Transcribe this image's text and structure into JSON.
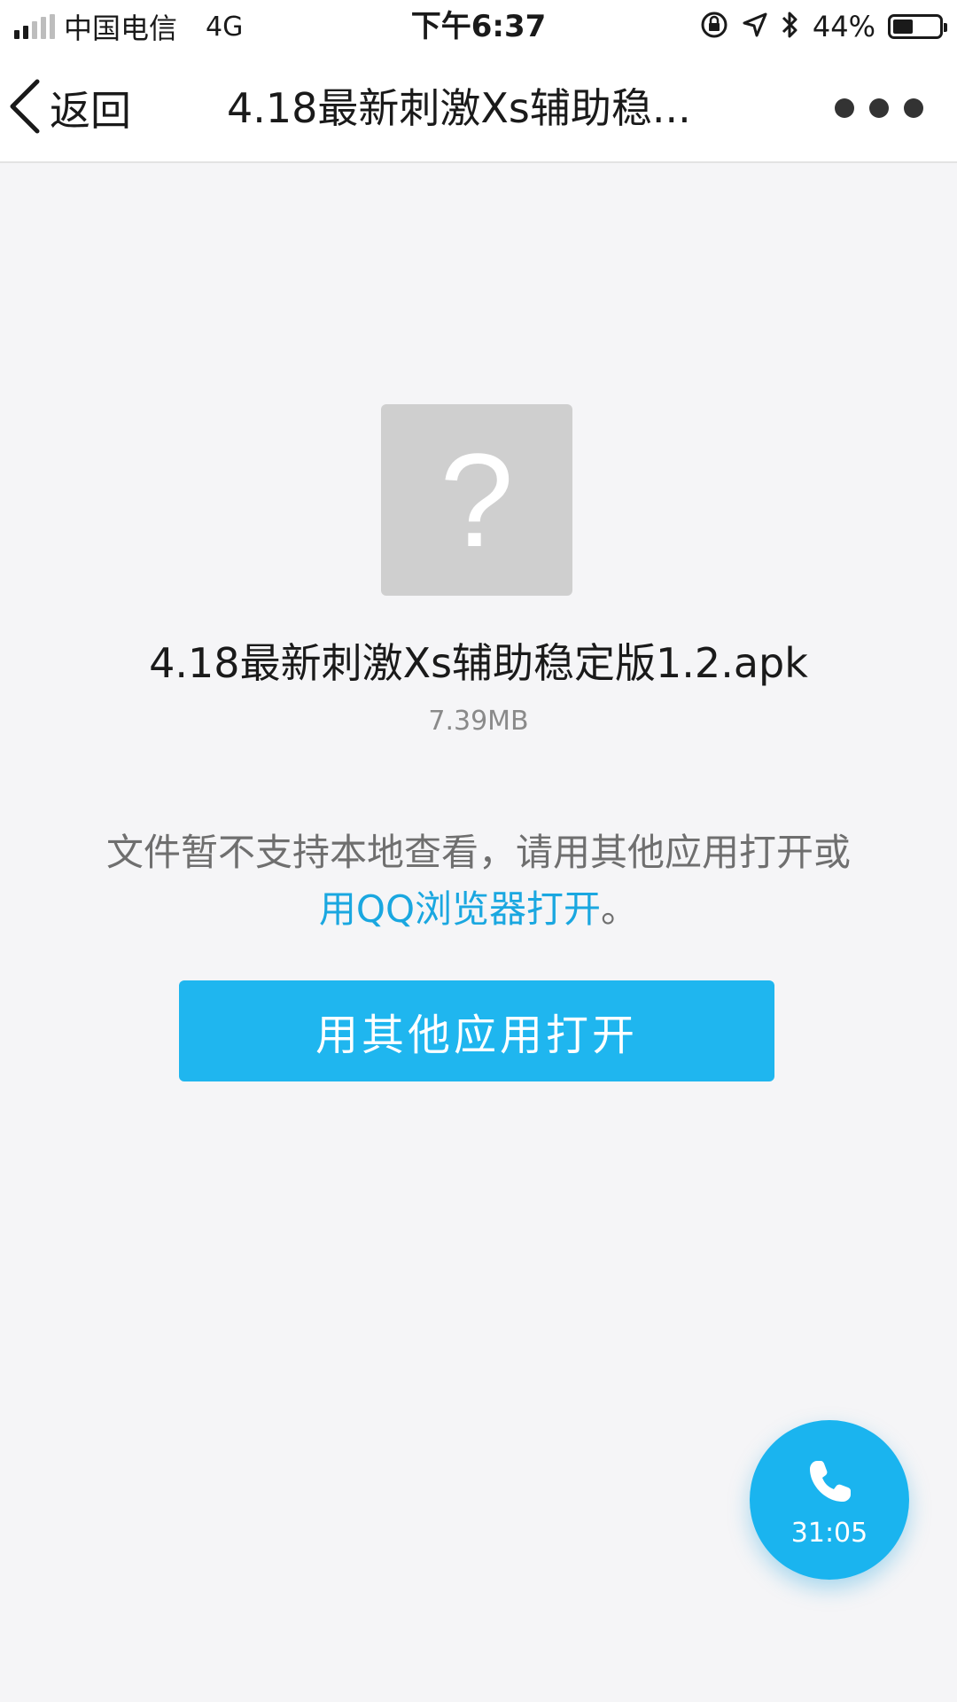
{
  "status_bar": {
    "carrier": "中国电信",
    "network": "4G",
    "time": "下午6:37",
    "battery_percent_text": "44%",
    "battery_level": 0.44
  },
  "nav": {
    "back_label": "返回",
    "title": "4.18最新刺激Xs辅助稳..."
  },
  "file": {
    "icon": "unknown-file-icon",
    "icon_glyph": "?",
    "name": "4.18最新刺激Xs辅助稳定版1.2.apk",
    "size": "7.39MB"
  },
  "message": {
    "text_before": "文件暂不支持本地查看，请用其他应用打开或",
    "link_text": "用QQ浏览器打开",
    "text_after": "。"
  },
  "primary_button": {
    "label": "用其他应用打开"
  },
  "call": {
    "icon": "phone-icon",
    "duration": "31:05"
  },
  "colors": {
    "accent": "#1fb6ef",
    "link": "#1aa7e0",
    "background": "#f5f5f7",
    "file_icon_bg": "#cfcfcf"
  }
}
